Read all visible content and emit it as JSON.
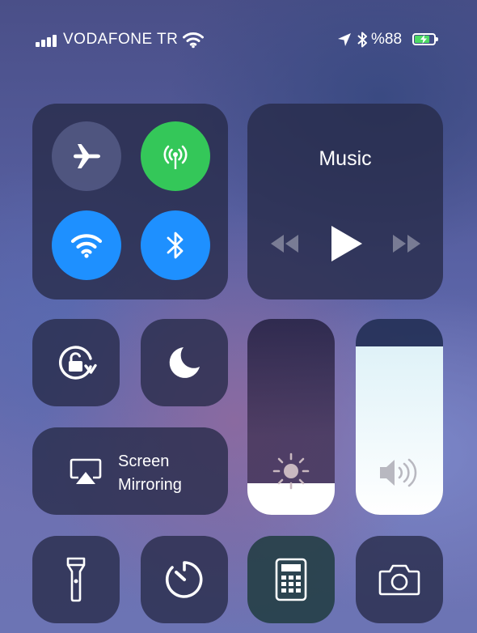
{
  "status_bar": {
    "carrier": "VODAFONE TR",
    "battery_text": "%88",
    "battery_level": 0.88,
    "battery_color": "#4cd964",
    "icons": [
      "cellular-signal-icon",
      "wifi-icon",
      "location-arrow-icon",
      "bluetooth-icon",
      "battery-charging-icon"
    ]
  },
  "connectivity": {
    "airplane": {
      "icon": "airplane-icon",
      "active": false
    },
    "cellular": {
      "icon": "cellular-data-icon",
      "active": true,
      "color": "#34c759"
    },
    "wifi": {
      "icon": "wifi-icon",
      "active": true,
      "color": "#1e90ff"
    },
    "bluetooth": {
      "icon": "bluetooth-icon",
      "active": true,
      "color": "#1e90ff"
    }
  },
  "music": {
    "title": "Music",
    "controls": [
      "rewind-icon",
      "play-icon",
      "fast-forward-icon"
    ]
  },
  "screen_mirroring": {
    "line1": "Screen",
    "line2": "Mirroring",
    "icon": "airplay-icon"
  },
  "sliders": {
    "brightness": {
      "icon": "sun-icon",
      "level": 0.16
    },
    "volume": {
      "icon": "speaker-icon",
      "level": 0.86
    }
  },
  "toggles": {
    "rotation_lock": "rotation-lock-icon",
    "do_not_disturb": "moon-icon"
  },
  "shortcuts": [
    "flashlight-icon",
    "timer-icon",
    "calculator-icon",
    "camera-icon"
  ]
}
